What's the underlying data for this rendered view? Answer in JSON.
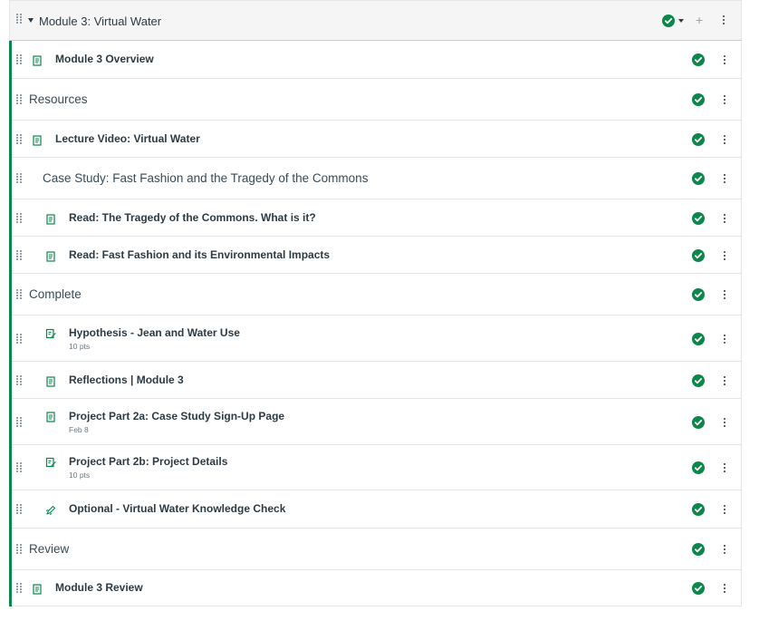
{
  "module": {
    "title": "Module 3: Virtual Water",
    "status_icon": "published-check-icon",
    "colors": {
      "published": "#0b874b",
      "accent_border": "#0b874b"
    }
  },
  "items": [
    {
      "kind": "item",
      "indent": 1,
      "icon": "page-icon",
      "title": "Module 3 Overview",
      "sub": ""
    },
    {
      "kind": "header",
      "indent": 0,
      "icon": "",
      "title": "Resources",
      "sub": ""
    },
    {
      "kind": "item",
      "indent": 1,
      "icon": "page-icon",
      "title": "Lecture Video: Virtual Water",
      "sub": ""
    },
    {
      "kind": "header",
      "indent": 1,
      "icon": "",
      "title": "Case Study: Fast Fashion and the Tragedy of the Commons",
      "sub": ""
    },
    {
      "kind": "item",
      "indent": 2,
      "icon": "page-icon",
      "title": "Read: The Tragedy of the Commons. What is it?",
      "sub": ""
    },
    {
      "kind": "item",
      "indent": 2,
      "icon": "page-icon",
      "title": "Read: Fast Fashion and its Environmental Impacts",
      "sub": ""
    },
    {
      "kind": "header",
      "indent": 0,
      "icon": "",
      "title": "Complete",
      "sub": ""
    },
    {
      "kind": "item",
      "indent": 2,
      "icon": "assignment-icon",
      "title": "Hypothesis - Jean and Water Use",
      "sub": "10 pts"
    },
    {
      "kind": "item",
      "indent": 2,
      "icon": "page-icon",
      "title": "Reflections | Module 3",
      "sub": ""
    },
    {
      "kind": "item",
      "indent": 2,
      "icon": "page-icon",
      "title": "Project Part 2a: Case Study Sign-Up Page",
      "sub": "Feb 8"
    },
    {
      "kind": "item",
      "indent": 2,
      "icon": "assignment-icon",
      "title": "Project Part 2b: Project Details",
      "sub": "10 pts"
    },
    {
      "kind": "item",
      "indent": 2,
      "icon": "quiz-icon",
      "title": "Optional - Virtual Water Knowledge Check",
      "sub": ""
    },
    {
      "kind": "header",
      "indent": 0,
      "icon": "",
      "title": "Review",
      "sub": ""
    },
    {
      "kind": "item",
      "indent": 1,
      "icon": "page-icon",
      "title": "Module 3 Review",
      "sub": ""
    }
  ]
}
